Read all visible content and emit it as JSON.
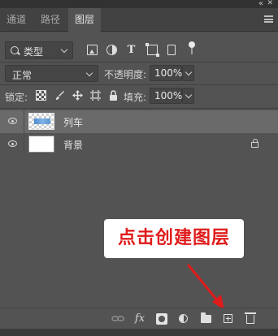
{
  "window": {
    "collapse_glyph": "«",
    "close_glyph": "✕"
  },
  "tabs": [
    {
      "label": "通道",
      "active": false
    },
    {
      "label": "路径",
      "active": false
    },
    {
      "label": "图层",
      "active": true
    }
  ],
  "filter": {
    "kind_label": "类型",
    "icons": [
      "image-filter-icon",
      "adjustment-filter-icon",
      "type-filter-icon",
      "shape-filter-icon",
      "smart-object-filter-icon",
      "filter-toggle-icon"
    ],
    "type_glyph": "T"
  },
  "blend": {
    "mode": "正常",
    "opacity_label": "不透明度:",
    "opacity_value": "100%"
  },
  "lock": {
    "label": "锁定:",
    "icons": [
      "lock-pixels-icon",
      "lock-image-icon",
      "lock-position-icon",
      "lock-artboard-icon",
      "lock-all-icon"
    ],
    "fill_label": "填充:",
    "fill_value": "100%"
  },
  "layers": [
    {
      "name": "列车",
      "selected": true,
      "locked": false,
      "thumb": "train"
    },
    {
      "name": "背景",
      "selected": false,
      "locked": true,
      "thumb": "white"
    }
  ],
  "annotation": {
    "text": "点击创建图层",
    "text_color": "#e01b1b",
    "arrow_color": "#e01b1b"
  },
  "bottom_bar": {
    "icons": [
      "link-layers-icon",
      "layer-style-icon",
      "add-mask-icon",
      "adjustment-layer-icon",
      "new-group-icon",
      "new-layer-icon",
      "delete-layer-icon"
    ],
    "fx_label": "fx"
  },
  "colors": {
    "panel": "#535353",
    "tab_bar": "#424242",
    "selected_row": "#6a6a6a"
  }
}
